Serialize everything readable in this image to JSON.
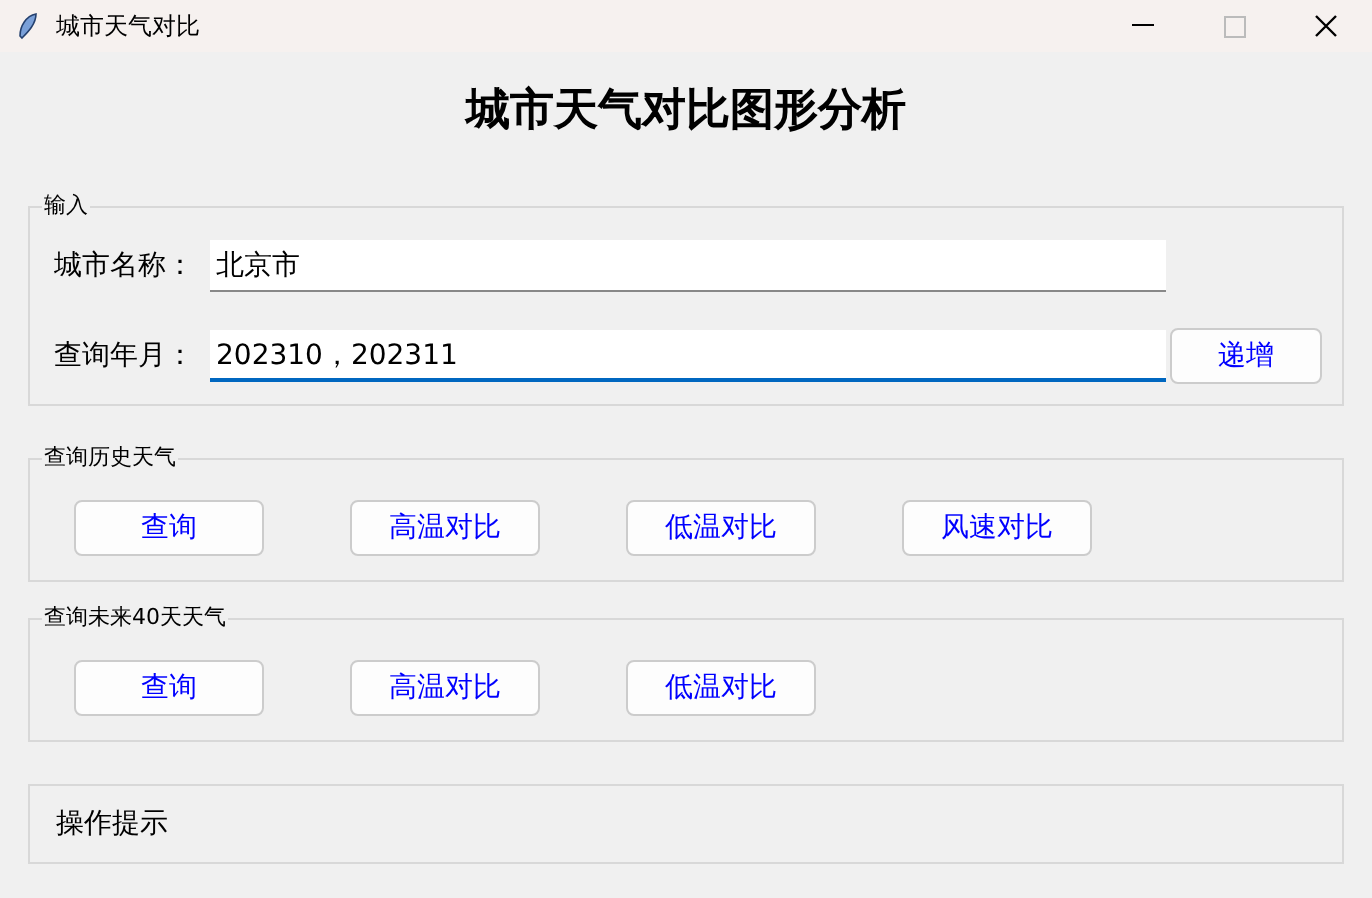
{
  "window": {
    "title": "城市天气对比"
  },
  "heading": "城市天气对比图形分析",
  "input_group": {
    "label": "输入",
    "fields": [
      {
        "label": "城市名称：",
        "value": "北京市",
        "focused": false
      },
      {
        "label": "查询年月：",
        "value": "202310，202311",
        "focused": true,
        "button": "递增"
      }
    ]
  },
  "groups": [
    {
      "label": "查询历史天气",
      "buttons": [
        "查询",
        "高温对比",
        "低温对比",
        "风速对比"
      ]
    },
    {
      "label": "查询未来40天天气",
      "buttons": [
        "查询",
        "高温对比",
        "低温对比"
      ]
    }
  ],
  "status_bar": {
    "text": "操作提示"
  }
}
